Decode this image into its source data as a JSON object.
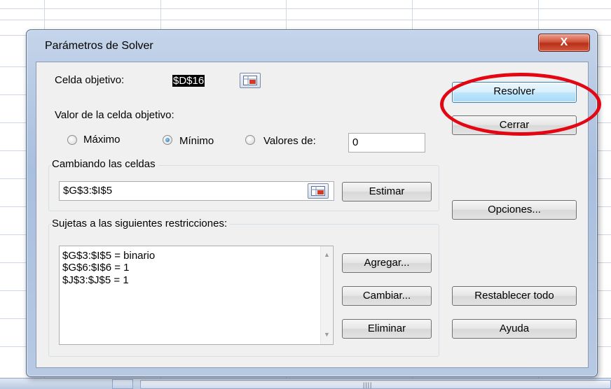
{
  "dialog": {
    "title": "Parámetros de Solver",
    "close_glyph": "X"
  },
  "target": {
    "label": "Celda objetivo:",
    "value": "$D$16"
  },
  "value_of": {
    "label": "Valor de la celda objetivo:",
    "options": [
      "Máximo",
      "Mínimo",
      "Valores de:"
    ],
    "selected": "Mínimo",
    "value_field": "0"
  },
  "changing": {
    "label": "Cambiando las celdas",
    "value": "$G$3:$I$5",
    "estimate_button": "Estimar"
  },
  "constraints": {
    "label": "Sujetas a las siguientes restricciones:",
    "items": [
      "$G$3:$I$5 = binario",
      "$G$6:$I$6 = 1",
      "$J$3:$J$5 = 1"
    ],
    "add_button": "Agregar...",
    "change_button": "Cambiar...",
    "delete_button": "Eliminar"
  },
  "side_buttons": {
    "solve": "Resolver",
    "close": "Cerrar",
    "options": "Opciones...",
    "reset": "Restablecer todo",
    "help": "Ayuda"
  },
  "colors": {
    "highlight": "#e30613",
    "dialog_face": "#f0f0f0",
    "default_button": "#bee6fd"
  },
  "icons": [
    "cell-picker-icon",
    "scroll-up-icon",
    "scroll-down-icon",
    "close-icon"
  ]
}
